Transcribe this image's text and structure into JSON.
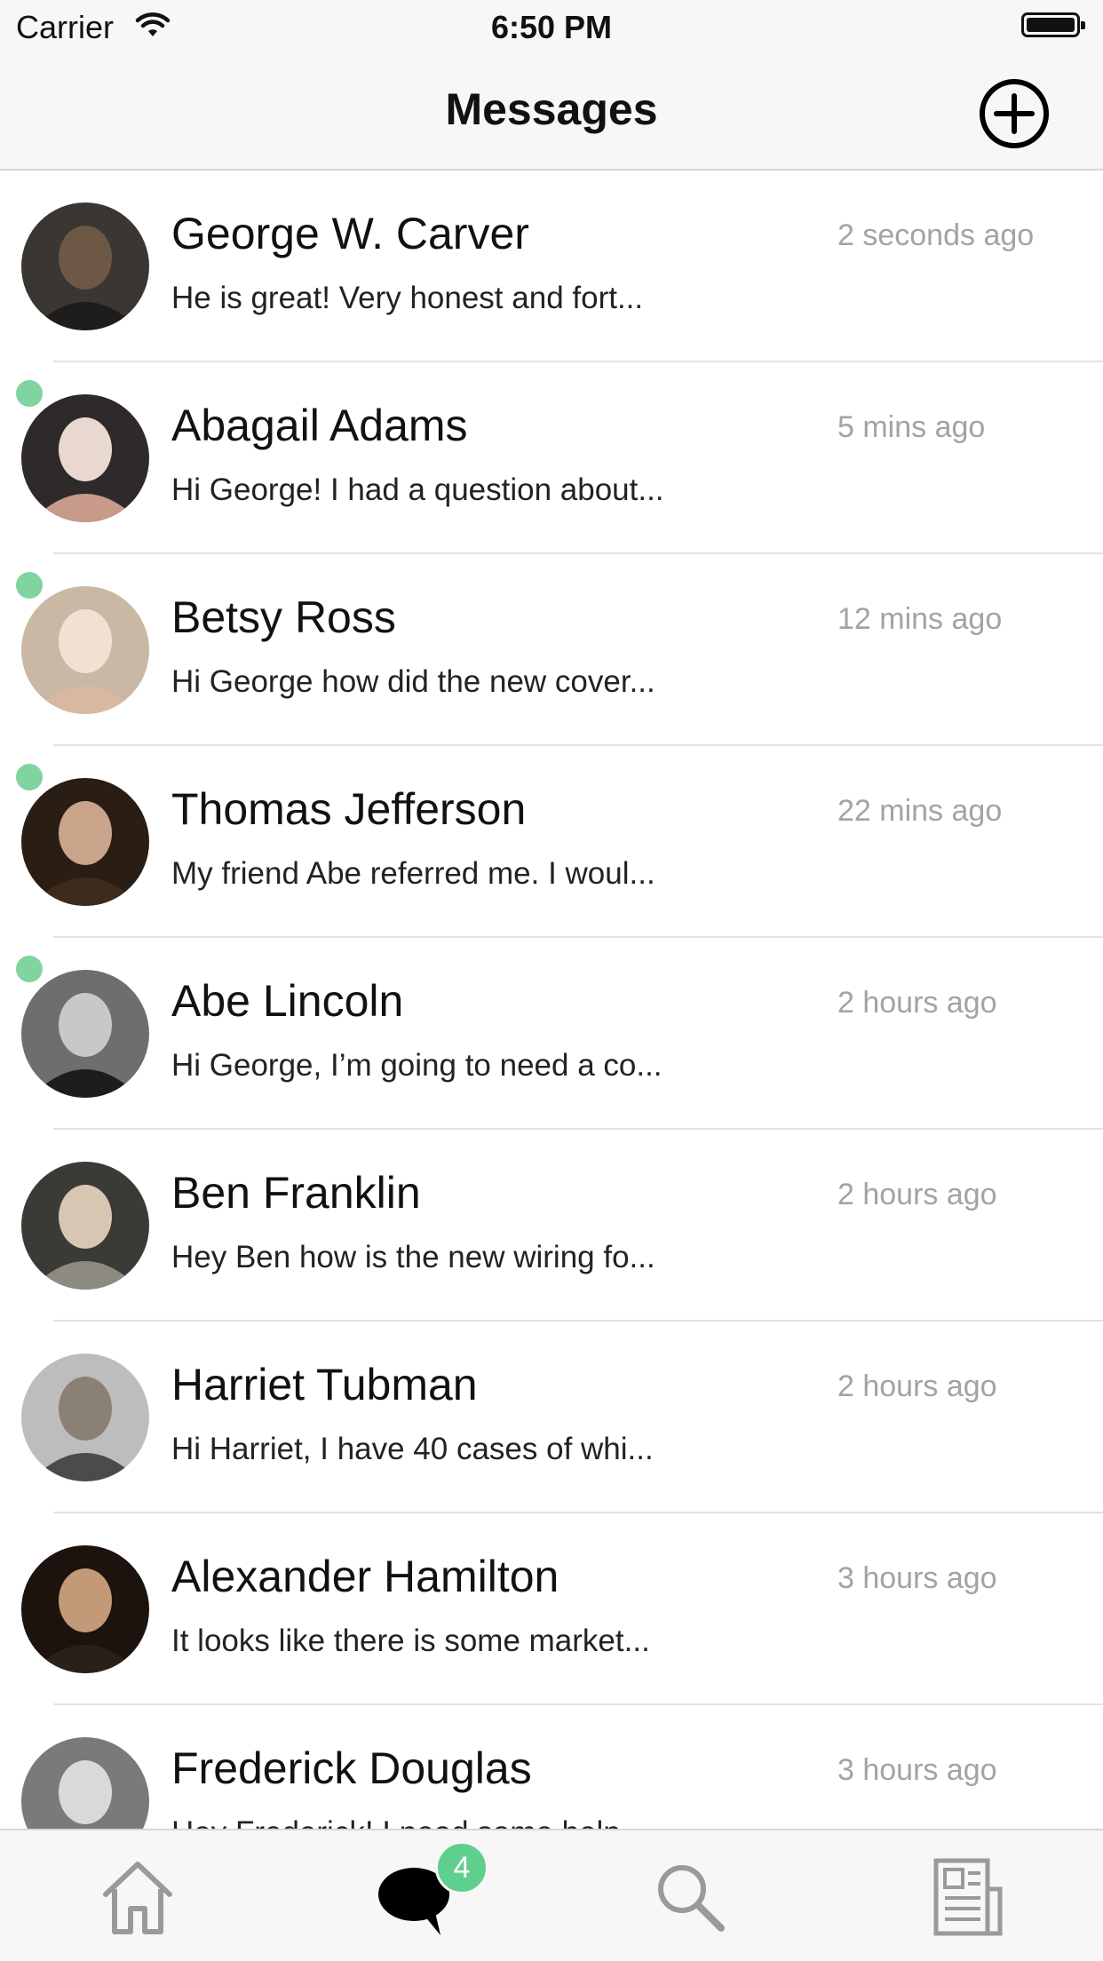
{
  "status_bar": {
    "carrier": "Carrier",
    "time": "6:50 PM",
    "icons": [
      "wifi-icon",
      "battery-icon"
    ]
  },
  "nav": {
    "title": "Messages",
    "compose_icon": "plus-circle-icon"
  },
  "colors": {
    "online": "#7fd4a0",
    "badge": "#5fcf8e",
    "timestamp": "#a3a3a3",
    "tab_inactive": "#9a9a9a",
    "tab_active": "#000000"
  },
  "conversations": [
    {
      "name": "George W. Carver",
      "time": "2 seconds ago",
      "preview": "He is great! Very honest and fort...",
      "online": false
    },
    {
      "name": "Abagail Adams",
      "time": "5 mins ago",
      "preview": "Hi George! I had a question about...",
      "online": true
    },
    {
      "name": "Betsy Ross",
      "time": "12 mins ago",
      "preview": "Hi George how did the new cover...",
      "online": true
    },
    {
      "name": "Thomas Jefferson",
      "time": "22 mins ago",
      "preview": "My friend Abe referred me. I woul...",
      "online": true
    },
    {
      "name": "Abe Lincoln",
      "time": "2 hours ago",
      "preview": "Hi George, I’m going to need a co...",
      "online": true
    },
    {
      "name": "Ben Franklin",
      "time": "2 hours ago",
      "preview": "Hey Ben how is the new wiring fo...",
      "online": false
    },
    {
      "name": "Harriet Tubman",
      "time": "2 hours ago",
      "preview": "Hi Harriet, I have 40 cases of whi...",
      "online": false
    },
    {
      "name": "Alexander Hamilton",
      "time": "3 hours ago",
      "preview": "It looks like there is some market...",
      "online": false
    },
    {
      "name": "Frederick Douglas",
      "time": "3 hours ago",
      "preview": "Hey Frederick! I need some help...",
      "online": false
    }
  ],
  "tab_bar": {
    "tabs": [
      {
        "icon": "home-icon",
        "active": false
      },
      {
        "icon": "chat-bubble-icon",
        "active": true
      },
      {
        "icon": "search-icon",
        "active": false
      },
      {
        "icon": "newspaper-icon",
        "active": false
      }
    ],
    "messages_badge": "4"
  }
}
